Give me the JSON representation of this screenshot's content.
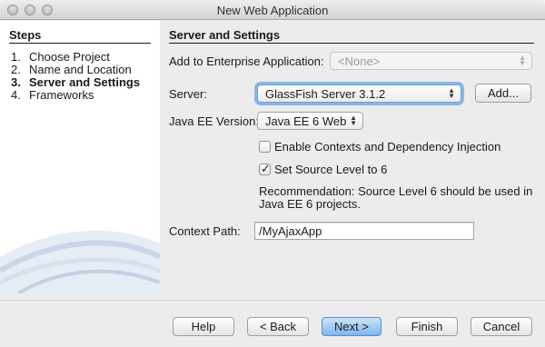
{
  "window": {
    "title": "New Web Application"
  },
  "steps": {
    "heading": "Steps",
    "items": [
      {
        "num": "1.",
        "label": "Choose Project"
      },
      {
        "num": "2.",
        "label": "Name and Location"
      },
      {
        "num": "3.",
        "label": "Server and Settings"
      },
      {
        "num": "4.",
        "label": "Frameworks"
      }
    ],
    "current": 2
  },
  "main": {
    "heading": "Server and Settings",
    "enterprise": {
      "label": "Add to Enterprise Application:",
      "value": "<None>",
      "enabled": false
    },
    "server": {
      "label": "Server:",
      "value": "GlassFish Server 3.1.2",
      "add_label": "Add..."
    },
    "java_ee": {
      "label": "Java EE Version:",
      "value": "Java EE 6 Web"
    },
    "cdi": {
      "label": "Enable Contexts and Dependency Injection",
      "checked": false
    },
    "source_level": {
      "label": "Set Source Level to 6",
      "checked": true
    },
    "recommendation_line1": "Recommendation: Source Level 6 should be used in",
    "recommendation_line2": "Java EE 6 projects.",
    "context_path": {
      "label": "Context Path:",
      "value": "/MyAjaxApp"
    }
  },
  "buttons": {
    "help": "Help",
    "back": "< Back",
    "next": "Next >",
    "finish": "Finish",
    "cancel": "Cancel"
  },
  "icons": {
    "select_arrows": "updown-chevron-icon",
    "check_mark": "checkmark-icon"
  },
  "colors": {
    "default_button": "#7db5ee",
    "focus_ring": "#8ab6e8"
  }
}
